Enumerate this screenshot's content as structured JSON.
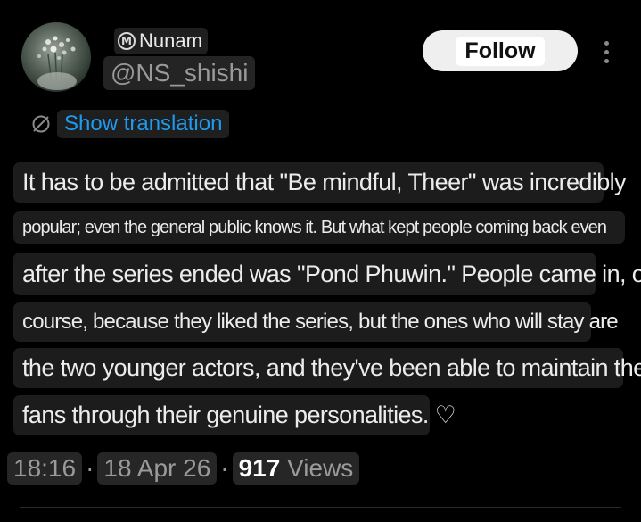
{
  "author": {
    "badge_letter": "M",
    "display_name": "Nunam",
    "handle": "@NS_shishi"
  },
  "actions": {
    "follow_label": "Follow"
  },
  "translation": {
    "label": "Show translation",
    "color": "#1d9bf0"
  },
  "post": {
    "lines": [
      "It has to be admitted that \"Be mindful, Theer\" was incredibly",
      "popular; even the general public knows it. But what kept people coming back even",
      "after the series ended was \"Pond Phuwin.\" People came in, of",
      "course, because they liked the series, but the ones who will stay are",
      "the two younger actors, and they've been able to maintain these",
      "fans through their genuine personalities. ♡"
    ]
  },
  "meta": {
    "time": "18:16",
    "separator": "·",
    "date": "18 Apr 26",
    "views_count": "917",
    "views_label": "Views"
  },
  "icons": {
    "avatar": "avatar-image",
    "more": "more-vertical-icon",
    "translate": "translate-icon"
  }
}
